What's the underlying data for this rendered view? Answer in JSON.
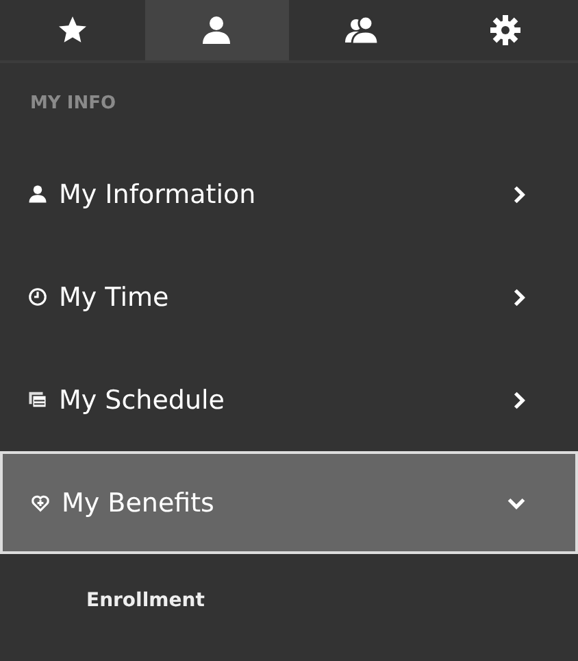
{
  "tabs": [
    {
      "kind": "star",
      "selected": false
    },
    {
      "kind": "user",
      "selected": true
    },
    {
      "kind": "users",
      "selected": false
    },
    {
      "kind": "gear",
      "selected": false
    }
  ],
  "section_heading": "MY INFO",
  "menu_items": [
    {
      "label": "My Information",
      "kind": "user",
      "selected": false,
      "expanded": false
    },
    {
      "label": "My Time",
      "kind": "clock",
      "selected": false,
      "expanded": false
    },
    {
      "label": "My Schedule",
      "kind": "schedule",
      "selected": false,
      "expanded": false
    },
    {
      "label": "My Benefits",
      "kind": "heart",
      "selected": true,
      "expanded": true,
      "children": [
        {
          "label": "Enrollment"
        }
      ]
    }
  ]
}
